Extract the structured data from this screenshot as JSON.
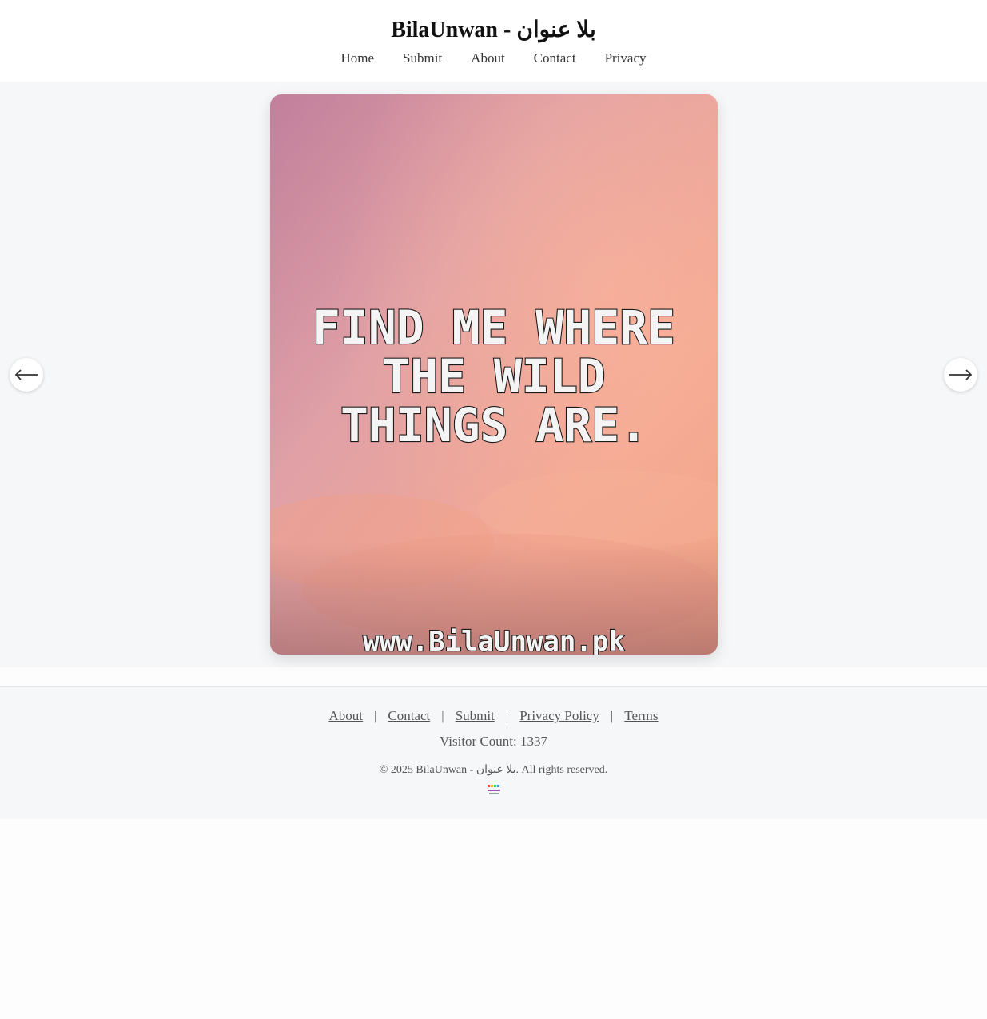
{
  "header": {
    "title": "BilaUnwan - بلا عنوان",
    "nav": [
      "Home",
      "Submit",
      "About",
      "Contact",
      "Privacy"
    ]
  },
  "slide": {
    "quote_lines": [
      "FIND ME WHERE",
      "THE WILD",
      "THINGS ARE."
    ],
    "watermark": "www.BilaUnwan.pk",
    "prev_icon": "arrow-left-icon",
    "next_icon": "arrow-right-icon"
  },
  "footer": {
    "links": [
      "About",
      "Contact",
      "Submit",
      "Privacy Policy",
      "Terms"
    ],
    "separator": "|",
    "visitor_count": "Visitor Count: 1337",
    "copyright": "© 2025 BilaUnwan - بلا عنوان. All rights reserved.",
    "logo_icon": "site-logo-icon"
  },
  "colors": {
    "sky_top": "#c98aa6",
    "sky_bottom": "#f3a58a",
    "viewer_bg": "#f6f7f9",
    "footer_bg": "#f6f7f9"
  }
}
